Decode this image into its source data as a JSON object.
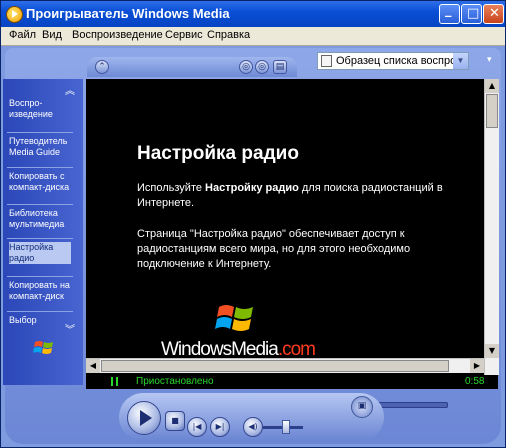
{
  "window": {
    "title": "Проигрыватель Windows Media"
  },
  "menu": [
    "Файл",
    "Вид",
    "Воспроизведение",
    "Сервис",
    "Справка"
  ],
  "taskbar": {
    "items": [
      {
        "label": "Воспро-\nизведение",
        "active": false
      },
      {
        "label": "Путеводитель\nMedia Guide",
        "active": false
      },
      {
        "label": "Копировать с\nкомпакт-диска",
        "active": false
      },
      {
        "label": "Библиотека\nмультимедиа",
        "active": false
      },
      {
        "label": "Настройка\nрадио",
        "active": true
      },
      {
        "label": "Копировать на\nкомпакт-диск",
        "active": false
      },
      {
        "label": "Выбор",
        "active": false
      }
    ]
  },
  "playlist": {
    "selected": "Образец списка воспроизведения"
  },
  "content": {
    "title": "Настройка радио",
    "p1_pre": "Используйте ",
    "p1_bold": "Настройку радио",
    "p1_post": " для поиска радиостанций в Интернете.",
    "p2": "Страница \"Настройка радио\" обеспечивает доступ к радиостанциям всего мира, но для этого необходимо подключение к Интернету.",
    "logo_main": "WindowsMedia",
    "logo_suffix": ".com"
  },
  "status": {
    "text": "Приостановлено",
    "time": "0:58"
  },
  "playback": {
    "seek_fraction": 0.25,
    "volume_fraction": 0.55
  },
  "colors": {
    "titlebar": "#0a4fd6",
    "status_text": "#29d829",
    "logo_dot": "#ff3b1f"
  },
  "icons": {
    "app": "wmp-icon",
    "play": "play-icon",
    "stop": "stop-icon",
    "prev": "previous-icon",
    "next": "next-icon",
    "mute": "mute-icon"
  }
}
